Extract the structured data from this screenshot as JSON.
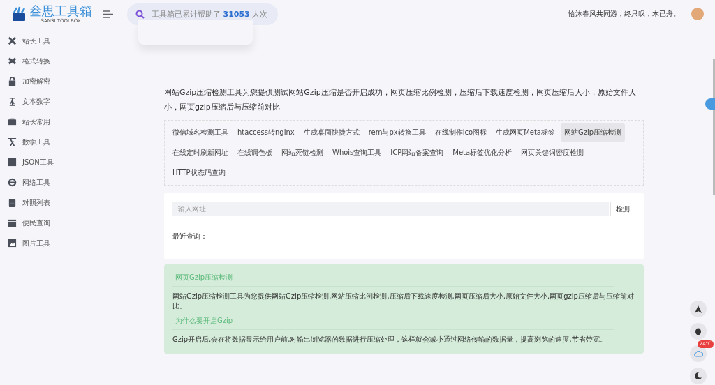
{
  "header": {
    "logo_title": "叁思工具箱",
    "logo_subtitle": "SANSI TOOLBOX",
    "search_prefix": "工具箱已累计帮助了",
    "search_count": "31053",
    "search_suffix": "人次",
    "motto": "恰沐春风共同游，终只叹，木已舟。"
  },
  "sidebar": {
    "items": [
      {
        "label": "站长工具"
      },
      {
        "label": "格式转换"
      },
      {
        "label": "加密解密"
      },
      {
        "label": "文本数字"
      },
      {
        "label": "站长常用"
      },
      {
        "label": "数学工具"
      },
      {
        "label": "JSON工具"
      },
      {
        "label": "网络工具"
      },
      {
        "label": "对照列表"
      },
      {
        "label": "便民查询"
      },
      {
        "label": "图片工具"
      }
    ]
  },
  "intro": "网站Gzip压缩检测工具为您提供测试网站Gzip压缩是否开启成功，网页压缩比例检测，压缩后下载速度检测，网页压缩后大小，原始文件大小，网页gzip压缩后与压缩前对比",
  "tools": [
    {
      "label": "微信域名检测工具",
      "selected": false
    },
    {
      "label": "htaccess转nginx",
      "selected": false
    },
    {
      "label": "生成桌面快捷方式",
      "selected": false
    },
    {
      "label": "rem与px转换工具",
      "selected": false
    },
    {
      "label": "在线制作ico图标",
      "selected": false
    },
    {
      "label": "生成网页Meta标签",
      "selected": false
    },
    {
      "label": "网站Gzip压缩检测",
      "selected": true
    },
    {
      "label": "在线定时刷新网址",
      "selected": false
    },
    {
      "label": "在线调色板",
      "selected": false
    },
    {
      "label": "网站死链检测",
      "selected": false
    },
    {
      "label": "Whois查询工具",
      "selected": false
    },
    {
      "label": "ICP网站备案查询",
      "selected": false
    },
    {
      "label": "Meta标签优化分析",
      "selected": false
    },
    {
      "label": "网页关键词密度检测",
      "selected": false
    },
    {
      "label": "HTTP状态码查询",
      "selected": false
    }
  ],
  "form": {
    "placeholder": "输入网址",
    "button": "检测",
    "recent_label": "最近查询："
  },
  "info": [
    {
      "title": "网页Gzip压缩检测",
      "text": "网站Gzip压缩检测工具为您提供网站Gzip压缩检测,网站压缩比例检测,压缩后下载速度检测,网页压缩后大小,原始文件大小,网页gzip压缩后与压缩前对比。"
    },
    {
      "title": "为什么要开启Gzip",
      "text": "Gzip开启后,会在将数据显示给用户前,对输出浏览器的数据进行压缩处理，这样就会减小通过网络传输的数据量，提高浏览的速度,节省带宽。"
    }
  ],
  "weather_badge": "24°C"
}
